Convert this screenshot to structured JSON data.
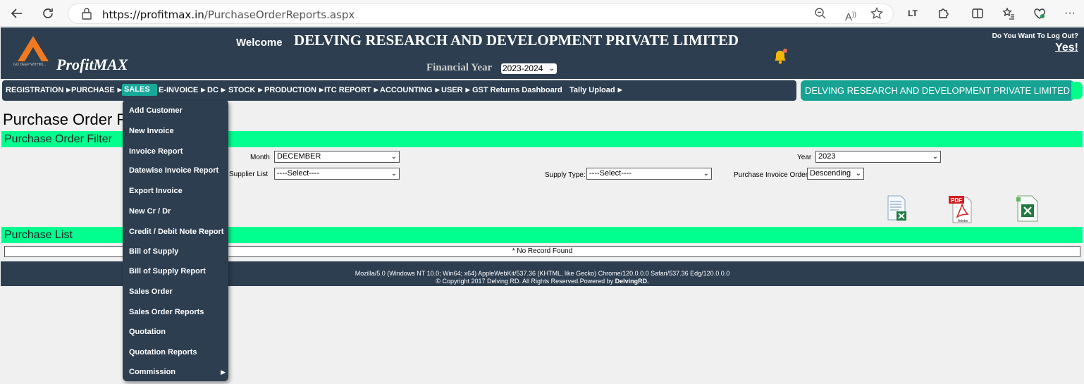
{
  "browser": {
    "url_host": "https://profitmax.in",
    "url_path": "/PurchaseOrderReports.aspx"
  },
  "header": {
    "logo_tagline": "GO DEEP WITHIN...",
    "brand": "ProfitMAX",
    "welcome": "Welcome",
    "company": "DELVING RESEARCH AND DEVELOPMENT PRIVATE LIMITED",
    "fy_label": "Financial Year",
    "fy_value": "2023-2024",
    "logout_question": "Do You Want To Log Out?",
    "logout_yes": "Yes!"
  },
  "nav": {
    "items": [
      "REGISTRATION",
      "PURCHASE",
      "SALES",
      "E-INVOICE",
      "DC",
      "STOCK",
      "PRODUCTION",
      "ITC REPORT",
      "ACCOUNTING",
      "USER",
      "GST Returns Dashboard",
      "Tally Upload"
    ],
    "company_pill": "DELVING RESEARCH AND DEVELOPMENT PRIVATE LIMITED"
  },
  "page": {
    "title": "Purchase Order Re",
    "filter_section": "Purchase Order Filter",
    "list_section": "Purchase List",
    "no_record": "* No Record Found"
  },
  "filters": {
    "month_label": "Month",
    "month_value": "DECEMBER",
    "year_label": "Year",
    "year_value": "2023",
    "supplier_label": "Supplier List",
    "supplier_value": "----Select----",
    "supply_type_label": "Supply Type:",
    "supply_type_value": "----Select----",
    "order_label": "Purchase Invoice Order:",
    "order_value": "Descending"
  },
  "exports": {
    "pdf_tag": "PDF",
    "pdf_brand": "Adobe"
  },
  "sales_menu": {
    "items": [
      "Add Customer",
      "New Invoice",
      "Invoice Report",
      "Datewise Invoice Report",
      "Export Invoice",
      "New Cr / Dr",
      "Credit / Debit Note Report",
      "Bill of Supply",
      "Bill of Supply Report",
      "Sales Order",
      "Sales Order Reports",
      "Quotation",
      "Quotation Reports",
      "Commission"
    ]
  },
  "footer": {
    "user_agent": "Mozilla/5.0 (Windows NT 10.0; Win64; x64) AppleWebKit/537.36 (KHTML, like Gecko) Chrome/120.0.0.0 Safari/537.36 Edg/120.0.0.0",
    "copyright": "© Copyright 2017 Delving RD. All Rights Reserved.Powered by ",
    "powered_link": "DelvingRD."
  },
  "colors": {
    "navy": "#2d3e50",
    "teal": "#16a394",
    "green_bar": "#00ff8f",
    "bell": "#f5b800"
  }
}
